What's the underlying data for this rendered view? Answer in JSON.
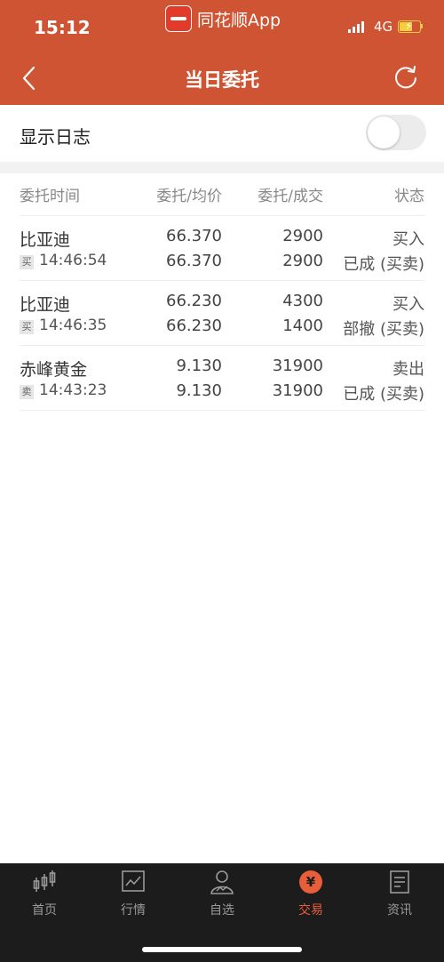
{
  "status_bar": {
    "time": "15:12",
    "app_name": "同花顺App",
    "network": "4G",
    "battery_level": 0.6,
    "signal_bars": 4
  },
  "nav": {
    "title": "当日委托",
    "back_icon": "chevron-left-icon",
    "refresh_icon": "refresh-icon"
  },
  "log": {
    "label": "显示日志",
    "enabled": false
  },
  "table": {
    "headers": [
      "委托时间",
      "委托/均价",
      "委托/成交",
      "状态"
    ],
    "rows": [
      {
        "name": "比亚迪",
        "tag": "买",
        "time": "14:46:54",
        "price1": "66.370",
        "price2": "66.370",
        "qty1": "2900",
        "qty2": "2900",
        "status1": "买入",
        "status2": "已成 (买卖)"
      },
      {
        "name": "比亚迪",
        "tag": "买",
        "time": "14:46:35",
        "price1": "66.230",
        "price2": "66.230",
        "qty1": "4300",
        "qty2": "1400",
        "status1": "买入",
        "status2": "部撤 (买卖)"
      },
      {
        "name": "赤峰黄金",
        "tag": "卖",
        "time": "14:43:23",
        "price1": "9.130",
        "price2": "9.130",
        "qty1": "31900",
        "qty2": "31900",
        "status1": "卖出",
        "status2": "已成 (买卖)"
      }
    ]
  },
  "tabs": [
    {
      "label": "首页",
      "icon": "home-candlestick-icon"
    },
    {
      "label": "行情",
      "icon": "market-chart-icon"
    },
    {
      "label": "自选",
      "icon": "watchlist-user-icon"
    },
    {
      "label": "交易",
      "icon": "trade-yen-icon",
      "active": true
    },
    {
      "label": "资讯",
      "icon": "news-document-icon"
    }
  ],
  "colors": {
    "brand": "#cf5433",
    "active_tab": "#e85d3a",
    "tabbar_bg": "#1c1c1c"
  }
}
